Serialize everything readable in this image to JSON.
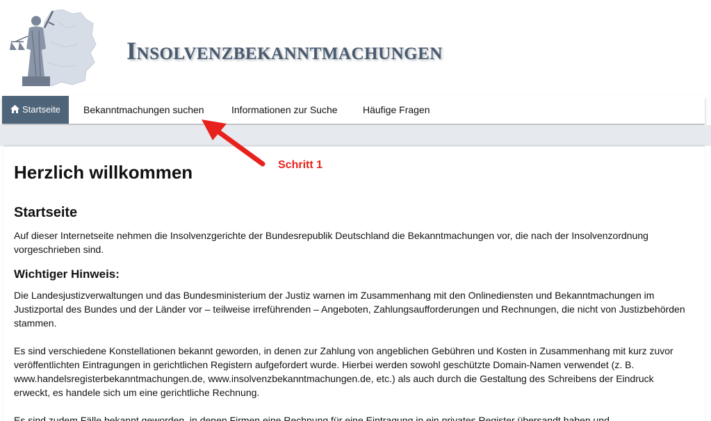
{
  "header": {
    "site_title": "Insolvenzbekanntmachungen"
  },
  "nav": {
    "items": [
      {
        "label": "Startseite",
        "icon": "home-icon",
        "active": true
      },
      {
        "label": "Bekanntmachungen suchen"
      },
      {
        "label": "Informationen zur Suche"
      },
      {
        "label": "Häufige Fragen"
      }
    ]
  },
  "annotation": {
    "label": "Schritt 1",
    "color": "#e8211c"
  },
  "content": {
    "welcome": "Herzlich willkommen",
    "heading_start": "Startseite",
    "intro": "Auf dieser Internetseite nehmen die Insolvenzgerichte der Bundesrepublik Deutschland die Bekanntmachungen vor, die nach der Insolvenzordnung vorgeschrieben sind.",
    "heading_hint": "Wichtiger Hinweis:",
    "hint_p1": "Die Landesjustizverwaltungen und das Bundesministerium der Justiz warnen im Zusammenhang mit den Onlinediensten und Bekanntmachungen im Justizportal des Bundes und der Länder vor – teilweise irreführenden – Angeboten, Zahlungsaufforderungen und Rechnungen, die nicht von Justizbehörden stammen.",
    "hint_p2": "Es sind verschiedene Konstellationen bekannt geworden, in denen zur Zahlung von angeblichen Gebühren und Kosten in Zusammenhang mit kurz zuvor veröffentlichten Eintragungen in gerichtlichen Registern aufgefordert wurde. Hierbei werden sowohl geschützte Domain-Namen verwendet (z. B. www.handelsregisterbekanntmachungen.de, www.insolvenzbekanntmachungen.de, etc.) als auch durch die Gestaltung des Schreibens der Eindruck erweckt, es handele sich um eine gerichtliche Rechnung.",
    "hint_p3": "Es sind zudem Fälle bekannt geworden, in denen Firmen eine Rechnung für eine Eintragung in ein privates Register übersandt haben und"
  },
  "colors": {
    "nav_active_bg": "#4e6478",
    "title_color": "#4a5a6e",
    "band_bg": "#e6e9ee"
  }
}
